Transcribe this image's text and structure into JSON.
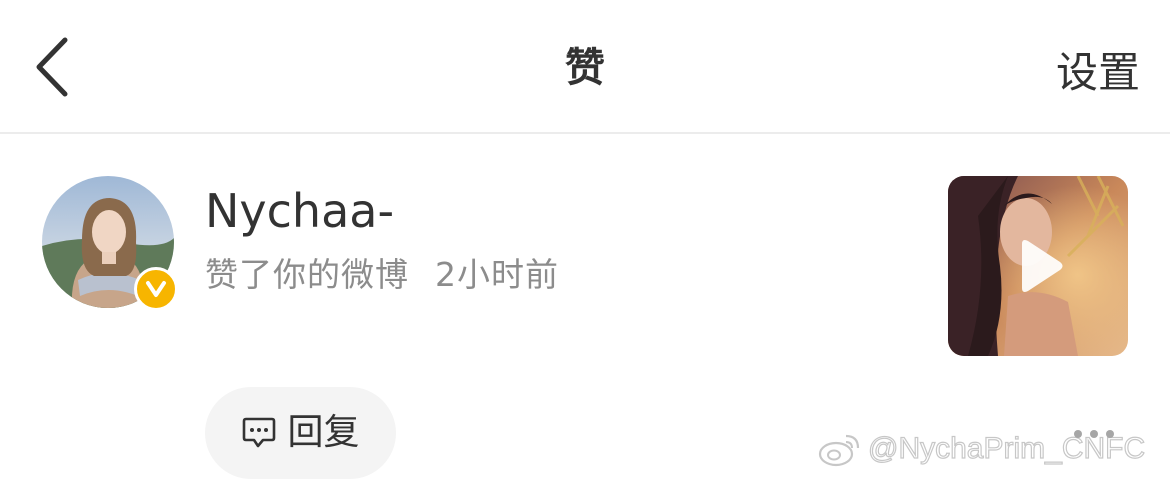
{
  "header": {
    "back_icon": "chevron-left-icon",
    "title": "赞",
    "settings_label": "设置"
  },
  "notification": {
    "user_name": "Nychaa-",
    "verified": true,
    "verified_badge_label": "V",
    "verified_color": "#f7b500",
    "action": "赞了你的微博",
    "time": "2小时前",
    "post_thumbnail_type": "video",
    "play_icon": "play-icon",
    "reply_icon": "comment-bubble-icon",
    "reply_label": "回复",
    "more_icon": "more-dots-icon"
  },
  "watermark": {
    "logo": "weibo-logo",
    "text": "@NychaPrim_CNFC"
  }
}
